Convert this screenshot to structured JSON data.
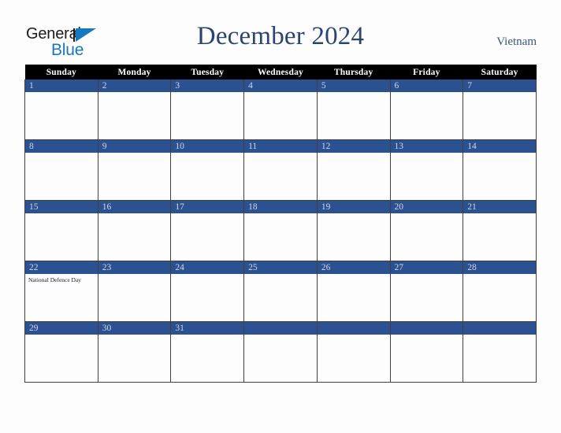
{
  "brand": {
    "line1": "General",
    "line2": "Blue",
    "triangle_icon": "brand-triangle-icon",
    "accent_color": "#1779bd"
  },
  "header": {
    "title": "December 2024",
    "country": "Vietnam",
    "title_color": "#2b4570",
    "country_color": "#3c5480"
  },
  "calendar": {
    "month": "December",
    "year": "2024",
    "weekday_headers": [
      "Sunday",
      "Monday",
      "Tuesday",
      "Wednesday",
      "Thursday",
      "Friday",
      "Saturday"
    ],
    "header_bg_color": "#000000",
    "daynum_bg_color": "#2c5191",
    "daynum_text_color": "#cfd7e6",
    "weeks": [
      [
        {
          "day": "1",
          "events": []
        },
        {
          "day": "2",
          "events": []
        },
        {
          "day": "3",
          "events": []
        },
        {
          "day": "4",
          "events": []
        },
        {
          "day": "5",
          "events": []
        },
        {
          "day": "6",
          "events": []
        },
        {
          "day": "7",
          "events": []
        }
      ],
      [
        {
          "day": "8",
          "events": []
        },
        {
          "day": "9",
          "events": []
        },
        {
          "day": "10",
          "events": []
        },
        {
          "day": "11",
          "events": []
        },
        {
          "day": "12",
          "events": []
        },
        {
          "day": "13",
          "events": []
        },
        {
          "day": "14",
          "events": []
        }
      ],
      [
        {
          "day": "15",
          "events": []
        },
        {
          "day": "16",
          "events": []
        },
        {
          "day": "17",
          "events": []
        },
        {
          "day": "18",
          "events": []
        },
        {
          "day": "19",
          "events": []
        },
        {
          "day": "20",
          "events": []
        },
        {
          "day": "21",
          "events": []
        }
      ],
      [
        {
          "day": "22",
          "events": [
            "National Defence Day"
          ]
        },
        {
          "day": "23",
          "events": []
        },
        {
          "day": "24",
          "events": []
        },
        {
          "day": "25",
          "events": []
        },
        {
          "day": "26",
          "events": []
        },
        {
          "day": "27",
          "events": []
        },
        {
          "day": "28",
          "events": []
        }
      ],
      [
        {
          "day": "29",
          "events": []
        },
        {
          "day": "30",
          "events": []
        },
        {
          "day": "31",
          "events": []
        },
        {
          "day": "",
          "events": []
        },
        {
          "day": "",
          "events": []
        },
        {
          "day": "",
          "events": []
        },
        {
          "day": "",
          "events": []
        }
      ]
    ]
  }
}
